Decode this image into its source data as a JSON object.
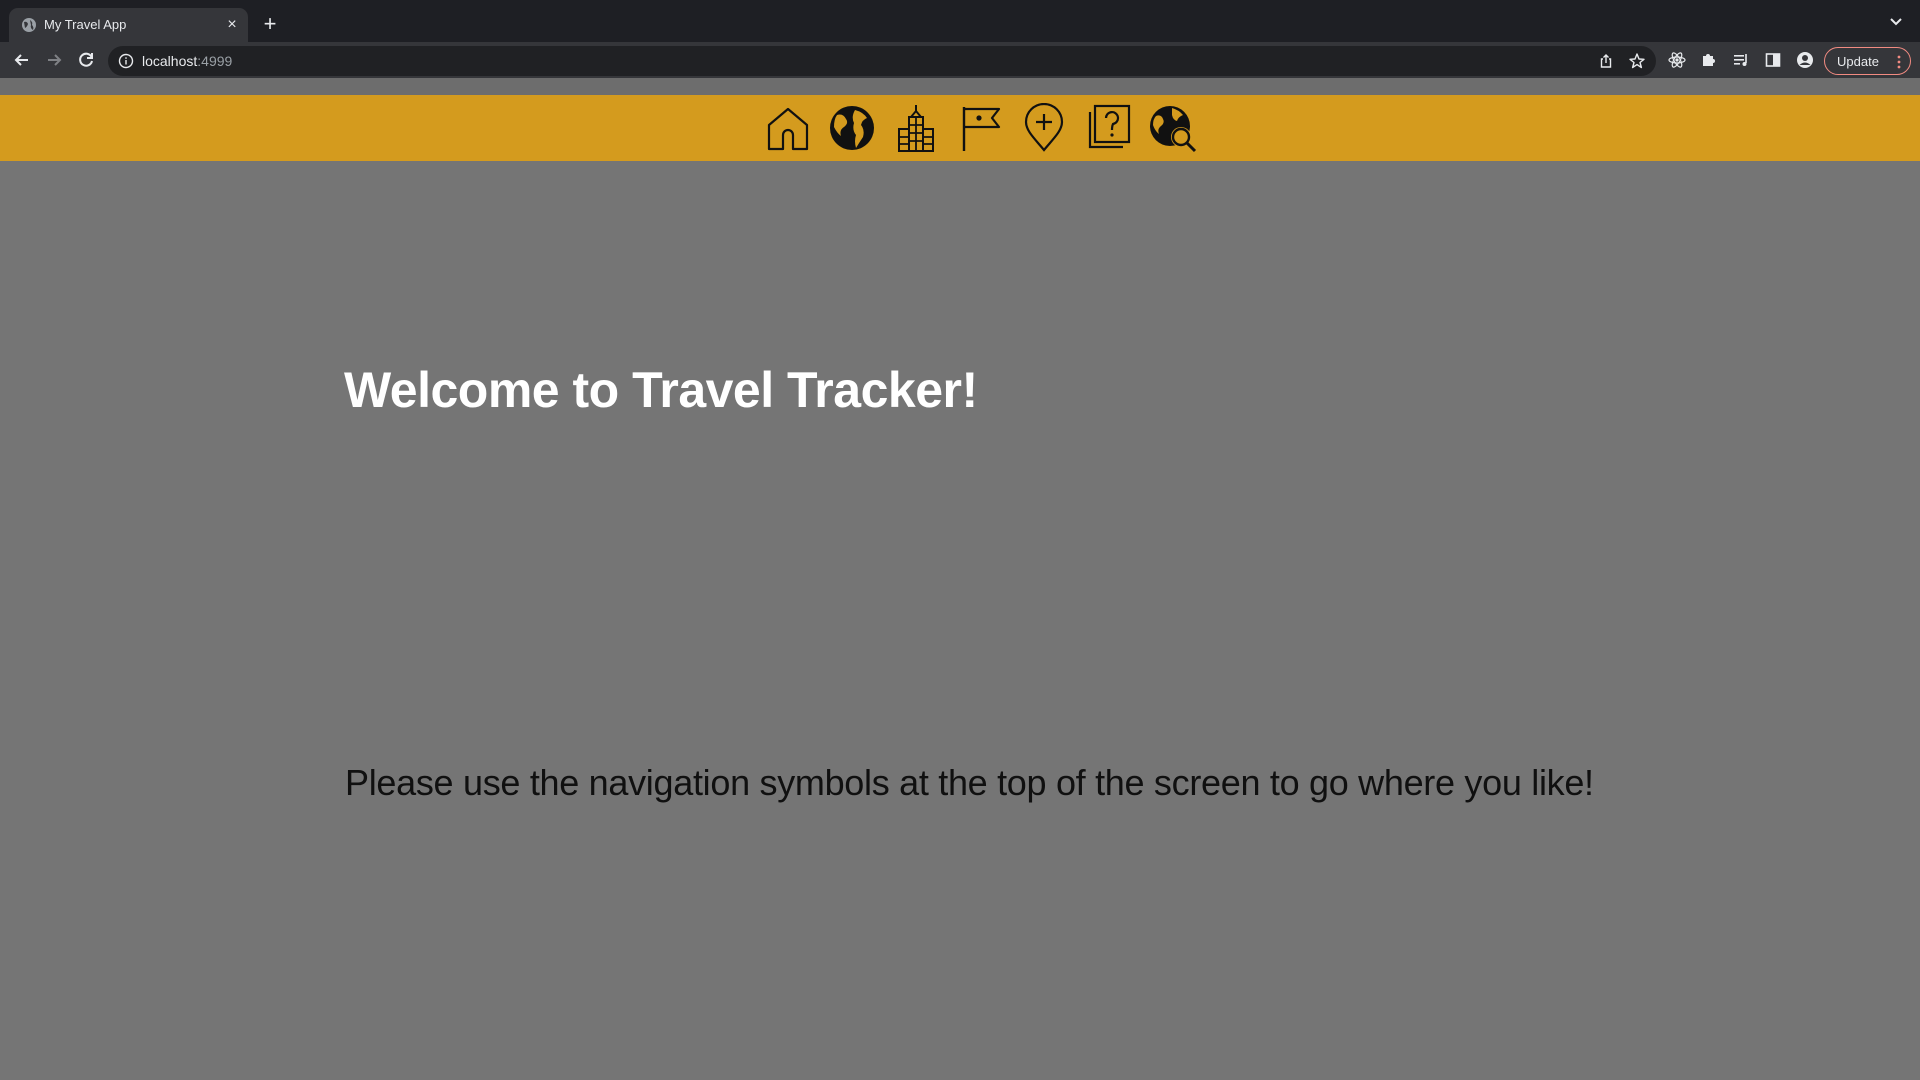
{
  "browser": {
    "tab_title": "My Travel App",
    "tab_close": "×",
    "new_tab": "+",
    "url_host": "localhost",
    "url_port": ":4999",
    "update_label": "Update",
    "colors": {
      "tab_strip": "#1e1f24",
      "toolbar": "#35363a",
      "omnibox": "#202124",
      "update_border": "#f28b82"
    }
  },
  "navbar": {
    "color": "#d49b1e",
    "icons": [
      "home-icon",
      "globe-icon",
      "city-buildings-icon",
      "flag-icon",
      "add-location-pin-icon",
      "help-question-icon",
      "globe-search-icon"
    ]
  },
  "main": {
    "title": "Welcome to Travel Tracker!",
    "instructions": "Please use the navigation symbols at the top of the screen to go where you like!",
    "background": "#757575"
  }
}
